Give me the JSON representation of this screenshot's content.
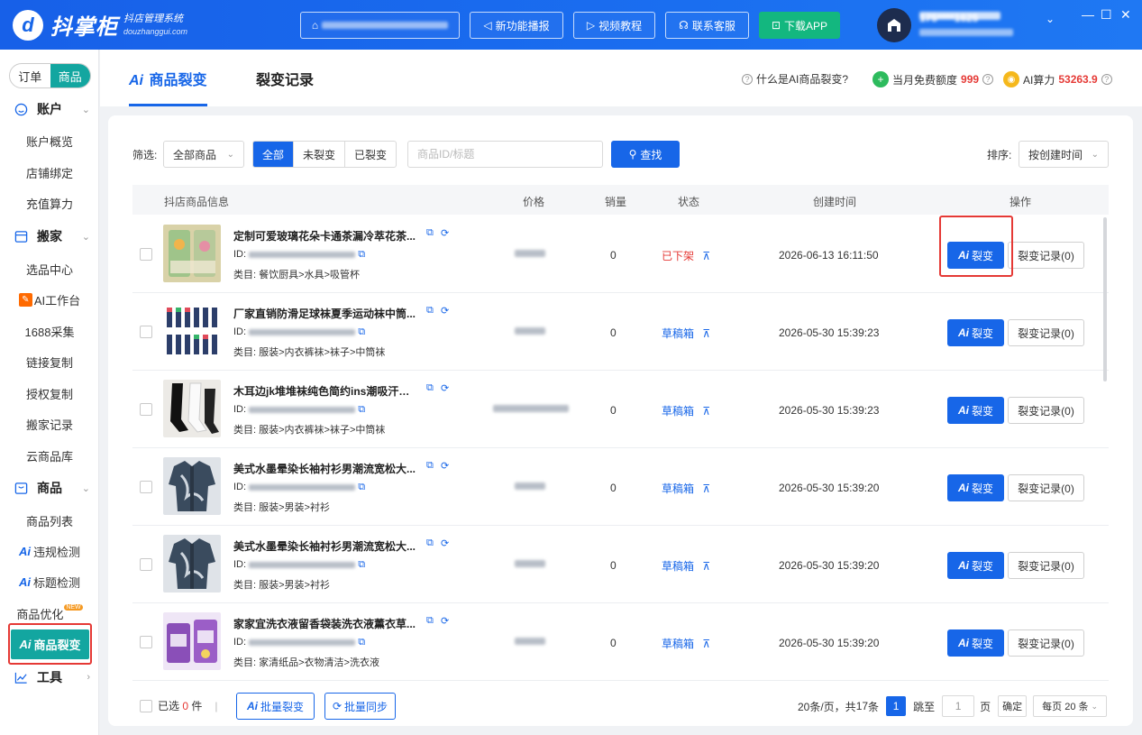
{
  "app": {
    "logo_text": "抖掌柜",
    "logo_sub": "抖店管理系统",
    "logo_domain": "douzhanggui.com",
    "user_phone": "175****1625"
  },
  "header": {
    "buttons": [
      {
        "label": "新功能播报",
        "icon": "speaker-icon"
      },
      {
        "label": "视频教程",
        "icon": "video-icon"
      },
      {
        "label": "联系客服",
        "icon": "headset-icon"
      },
      {
        "label": "下载APP",
        "icon": "download-icon"
      }
    ]
  },
  "sidebar": {
    "toggle": [
      "订单",
      "商品"
    ],
    "groups": [
      {
        "title": "账户",
        "items": [
          "账户概览",
          "店铺绑定",
          "充值算力"
        ]
      },
      {
        "title": "搬家",
        "items": [
          "选品中心",
          "AI工作台",
          "1688采集",
          "链接复制",
          "授权复制",
          "搬家记录",
          "云商品库"
        ]
      },
      {
        "title": "商品",
        "items": [
          "商品列表",
          "违规检测",
          "标题检测",
          "商品优化",
          "商品裂变"
        ]
      },
      {
        "title": "工具",
        "items": []
      }
    ],
    "ai_prefix": "Ai",
    "new_badge": "NEW"
  },
  "tabs": {
    "active": "商品裂变",
    "ai_prefix": "Ai",
    "other": "裂变记录",
    "help_link": "什么是AI商品裂变?",
    "free_quota_label": "当月免费额度",
    "free_quota_value": "999",
    "compute_label": "AI算力",
    "compute_value": "53263.9"
  },
  "filter": {
    "label": "筛选:",
    "scope": "全部商品",
    "status_options": [
      "全部",
      "未裂变",
      "已裂变"
    ],
    "search_placeholder": "商品ID/标题",
    "search_button": "查找",
    "sort_label": "排序:",
    "sort_value": "按创建时间"
  },
  "table": {
    "columns": [
      "抖店商品信息",
      "价格",
      "销量",
      "状态",
      "创建时间",
      "操作"
    ],
    "id_label": "ID:",
    "cat_label": "类目:",
    "action_ai": "裂变",
    "rows": [
      {
        "name": "定制可爱玻璃花朵卡通茶漏冷萃花茶...",
        "category": "餐饮厨具>水具>吸管杯",
        "sales": "0",
        "status": "已下架",
        "status_color": "#e53935",
        "created": "2026-06-13 16:11:50",
        "records": "裂变记录(0)",
        "thumb": "cup"
      },
      {
        "name": "厂家直销防滑足球袜夏季运动袜中筒...",
        "category": "服装>内衣裤袜>袜子>中筒袜",
        "sales": "0",
        "status": "草稿箱",
        "status_color": "#1766e8",
        "created": "2026-05-30 15:39:23",
        "records": "裂变记录(0)",
        "thumb": "socks"
      },
      {
        "name": "木耳边jk堆堆袜纯色简约ins潮吸汗中...",
        "category": "服装>内衣裤袜>袜子>中筒袜",
        "sales": "0",
        "status": "草稿箱",
        "status_color": "#1766e8",
        "created": "2026-05-30 15:39:23",
        "records": "裂变记录(0)",
        "thumb": "socks2"
      },
      {
        "name": "美式水墨晕染长袖衬衫男潮流宽松大...",
        "category": "服装>男装>衬衫",
        "sales": "0",
        "status": "草稿箱",
        "status_color": "#1766e8",
        "created": "2026-05-30 15:39:20",
        "records": "裂变记录(0)",
        "thumb": "shirt"
      },
      {
        "name": "美式水墨晕染长袖衬衫男潮流宽松大...",
        "category": "服装>男装>衬衫",
        "sales": "0",
        "status": "草稿箱",
        "status_color": "#1766e8",
        "created": "2026-05-30 15:39:20",
        "records": "裂变记录(0)",
        "thumb": "shirt"
      },
      {
        "name": "家家宜洗衣液留香袋装洗衣液薰衣草...",
        "category": "家清纸品>衣物清洁>洗衣液",
        "sales": "0",
        "status": "草稿箱",
        "status_color": "#1766e8",
        "created": "2026-05-30 15:39:20",
        "records": "裂变记录(0)",
        "thumb": "detergent"
      }
    ]
  },
  "footer": {
    "selected_label": "已选",
    "selected_count": "0",
    "selected_unit": "件",
    "batch_ai": "批量裂变",
    "batch_sync": "批量同步",
    "page_info_prefix": "20条/页，共",
    "total": "17",
    "total_unit": "条",
    "current_page": "1",
    "jump_label": "跳至",
    "jump_value": "1",
    "page_unit": "页",
    "confirm": "确定",
    "per_page": "每页 20 条"
  },
  "colors": {
    "primary": "#1766e8",
    "teal": "#13a6a0",
    "danger": "#e53935",
    "green": "#13b77f"
  }
}
